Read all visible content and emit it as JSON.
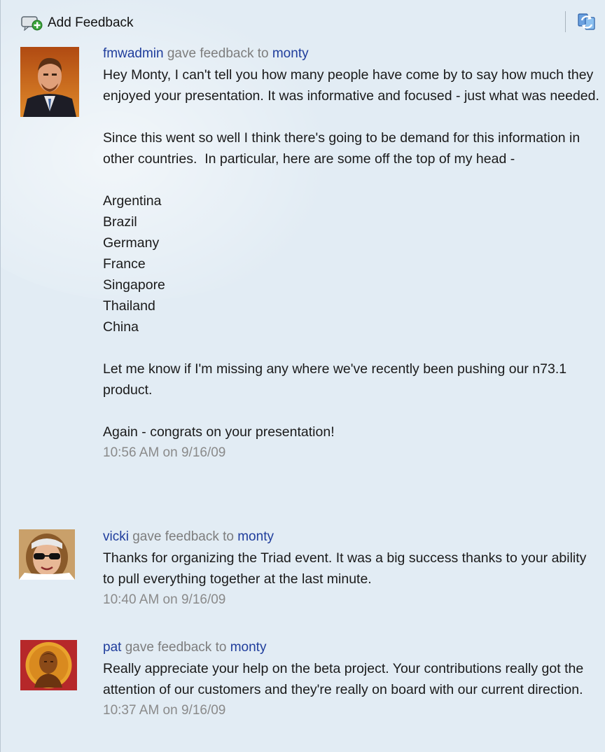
{
  "toolbar": {
    "add_feedback_label": "Add Feedback",
    "add_icon": "add-feedback-icon",
    "refresh_icon": "refresh-icon"
  },
  "colors": {
    "panel_background": "#e2ecf4",
    "link": "#1f3d9c",
    "muted_text": "#7d7d7d",
    "timestamp": "#8a8a8a"
  },
  "entries": [
    {
      "author": "fmwadmin",
      "action": "gave feedback to",
      "recipient": "monty",
      "body": "Hey Monty, I can't tell you how many people have come by to say how much they enjoyed your presentation. It was informative and focused - just what was needed.\n\nSince this went so well I think there's going to be demand for this information in other countries.  In particular, here are some off the top of my head -\n\nArgentina\nBrazil\nGermany\nFrance\nSingapore\nThailand\nChina\n\nLet me know if I'm missing any where we've recently been pushing our n73.1 product.\n\nAgain - congrats on your presentation!",
      "timestamp": "10:56 AM on 9/16/09"
    },
    {
      "author": "vicki",
      "action": "gave feedback to",
      "recipient": "monty",
      "body": "Thanks for organizing the Triad event. It was a big success thanks to your ability to pull everything together at the last minute.",
      "timestamp": "10:40 AM on 9/16/09"
    },
    {
      "author": "pat",
      "action": "gave feedback to",
      "recipient": "monty",
      "body": "Really appreciate your help on the beta project. Your contributions really got the attention of our customers and they're really on board with our current direction.",
      "timestamp": "10:37 AM on 9/16/09"
    }
  ]
}
